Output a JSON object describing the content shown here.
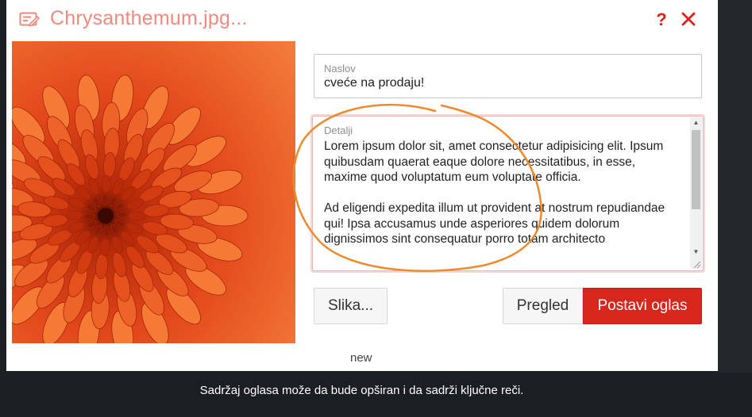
{
  "dialog": {
    "title": "Chrysanthemum.jpg...",
    "help_label": "?",
    "icons": {
      "title": "edit-note-icon",
      "close": "close-icon"
    }
  },
  "photo": {
    "subject": "orange chrysanthemum flower"
  },
  "form": {
    "naslov": {
      "label": "Naslov",
      "value": "cveće na prodaju!"
    },
    "detalji": {
      "label": "Detalji",
      "paragraphs": [
        "Lorem ipsum dolor sit, amet consectetur adipisicing elit. Ipsum quibusdam quaerat eaque dolore necessitatibus, in esse, maxime quod voluptatum eum voluptate officia.",
        "Ad eligendi expedita illum ut provident at nostrum repudiandae qui! Ipsa accusamus unde asperiores quidem dolorum dignissimos sint consequatur porro totam architecto"
      ]
    }
  },
  "buttons": {
    "image": "Slika...",
    "preview": "Pregled",
    "post": "Postavi oglas"
  },
  "status_label": "new",
  "caption": "Sadržaj oglasa može da bude opširan i da sadrži ključne reči.",
  "colors": {
    "accent": "#d9261c",
    "title": "#f08a7e",
    "annotation": "#ee8a2e"
  }
}
